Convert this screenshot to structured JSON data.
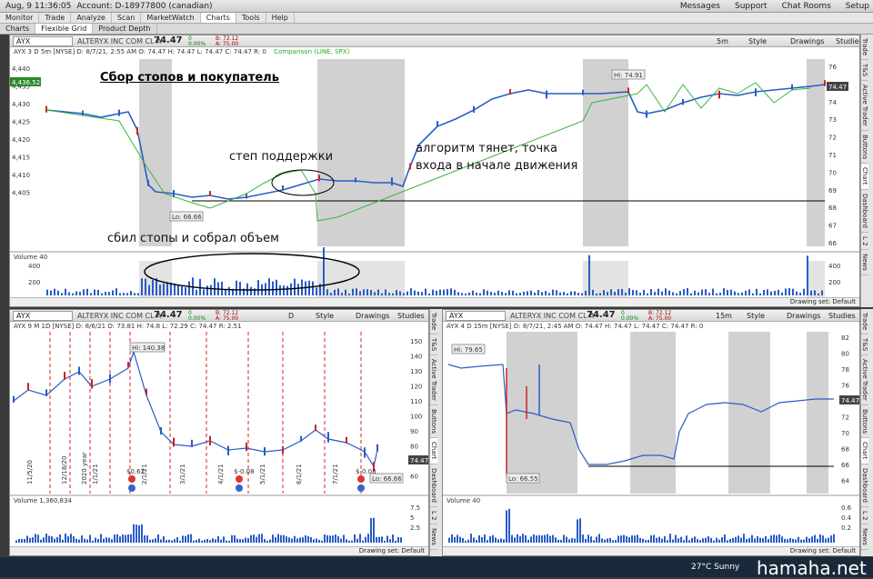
{
  "topbar": {
    "date_time": "Aug, 9  11:36:05",
    "account": "Account: D-18977800 (canadian)",
    "messages": "Messages",
    "support": "Support",
    "chat_rooms": "Chat Rooms",
    "setup": "Setup"
  },
  "menu": [
    "Monitor",
    "Trade",
    "Analyze",
    "Scan",
    "MarketWatch",
    "Charts",
    "Tools",
    "Help"
  ],
  "subtabs": [
    "Charts",
    "Flexible Grid",
    "Product Depth"
  ],
  "main_chart": {
    "symbol": "AYX",
    "company": "ALTERYX INC COM CL A",
    "price": "74.47",
    "change": "0",
    "change_pct": "0.00%",
    "bid": "B: 72.12",
    "ask": "A: 75.00",
    "info": "AYX 3 D 5m [NYSE]   D: 8/7/21, 2:55 AM   O: 74.47   H: 74.47   L: 74.47   C: 74.47   R: 0",
    "comparison": "Comparison (LINE, SPX)",
    "timeframe": "5m",
    "style_label": "Style",
    "drawings_label": "Drawings",
    "studies_label": "Studies",
    "left_axis_ticks": [
      "4,440",
      "4,435",
      "4,430",
      "4,425",
      "4,420",
      "4,415",
      "4,410",
      "4,405"
    ],
    "left_price_tag": "4,436.52",
    "right_axis_ticks": [
      "76",
      "75",
      "74",
      "73",
      "72",
      "71",
      "70",
      "69",
      "68",
      "67",
      "66"
    ],
    "right_price_tag": "74.47",
    "hi_label": "Hi: 74.91",
    "lo_label": "Lo: 66.66",
    "volume_label": "Volume",
    "volume_value": "40",
    "volume_unit": "<thousands>",
    "volume_ticks": [
      "400",
      "200"
    ],
    "x_ticks": [
      "11",
      "12",
      "13",
      "14",
      "15",
      "16",
      "17",
      "18",
      "19",
      "20",
      "21",
      "22",
      "23",
      "Thu",
      "1",
      "2",
      "15",
      "16",
      "17",
      "18",
      "19",
      "20",
      "21",
      "22",
      "Fri",
      "2",
      "15",
      "16",
      "17",
      "18",
      "19",
      "20",
      "21",
      "22",
      "Sat"
    ],
    "drawing_set": "Drawing set: Default"
  },
  "annotations": {
    "title": "Сбор стопов и покупатель",
    "support_step": "степ поддержки",
    "algo": "алгоритм тянет, точка входа в начале движения",
    "stops": "сбил стопы и собрал объем"
  },
  "left_chart": {
    "symbol": "AYX",
    "company": "ALTERYX INC COM CL A",
    "price": "74.47",
    "change": "0",
    "change_pct": "0.00%",
    "bid": "B: 72.12",
    "ask": "A: 75.00",
    "info": "AYX 9 M 1D [NYSE]   D: 8/6/21   O: 73.81   H: 74.8   L: 72.29   C: 74.47   R: 2.51",
    "timeframe": "D",
    "style_label": "Style",
    "drawings_label": "Drawings",
    "studies_label": "Studies",
    "right_axis_ticks": [
      "150",
      "140",
      "130",
      "120",
      "110",
      "100",
      "90",
      "80",
      "70",
      "60"
    ],
    "price_tag": "74.47",
    "hi_label": "Hi: 140.38",
    "lo_label": "Lo: 66.66",
    "volume_label": "Volume",
    "volume_value": "1,360,834",
    "volume_unit": "<millions>",
    "volume_ticks": [
      "7.5",
      "5",
      "2.5"
    ],
    "x_ticks": [
      "Dec",
      "21",
      "Feb",
      "Mar",
      "Apr",
      "May",
      "Jun",
      "Jul",
      "Aug"
    ],
    "event_dates": [
      "11/5/20",
      "12/18/20",
      "2020 year",
      "1/1/21",
      "2/1/21",
      "3/1/21",
      "4/1/21",
      "5/1/21",
      "6/1/21",
      "7/1/21"
    ],
    "dividend_labels": [
      "$0.62",
      "$-0.08",
      "$-0.08"
    ],
    "drawing_set": "Drawing set: Default"
  },
  "right_chart": {
    "symbol": "AYX",
    "company": "ALTERYX INC COM CL A",
    "price": "74.47",
    "change": "0",
    "change_pct": "0.00%",
    "bid": "B: 72.12",
    "ask": "A: 75.00",
    "info": "AYX 4 D 15m [NYSE]   D: 8/7/21, 2:45 AM   O: 74.47   H: 74.47   L: 74.47   C: 74.47   R: 0",
    "timeframe": "15m",
    "style_label": "Style",
    "drawings_label": "Drawings",
    "studies_label": "Studies",
    "right_axis_ticks": [
      "82",
      "80",
      "78",
      "76",
      "74",
      "72",
      "70",
      "68",
      "66",
      "64"
    ],
    "price_tag": "74.47",
    "hi_label": "Hi: 79.65",
    "lo_label": "Lo: 66.55",
    "volume_label": "Volume",
    "volume_value": "40",
    "volume_unit": "<millions>",
    "volume_ticks": [
      "0.6",
      "0.4",
      "0.2"
    ],
    "x_ticks": [
      "Wed",
      "Thu",
      "Fri",
      "Sat"
    ],
    "drawing_set": "Drawing set: Default"
  },
  "side_tabs": [
    "Trade",
    "T&S",
    "Active Trader",
    "Buttons",
    "Chart",
    "Dashboard",
    "L 2",
    "News"
  ],
  "taskbar": {
    "weather": "27°C  Sunny",
    "watermark": "hamaha.net"
  }
}
